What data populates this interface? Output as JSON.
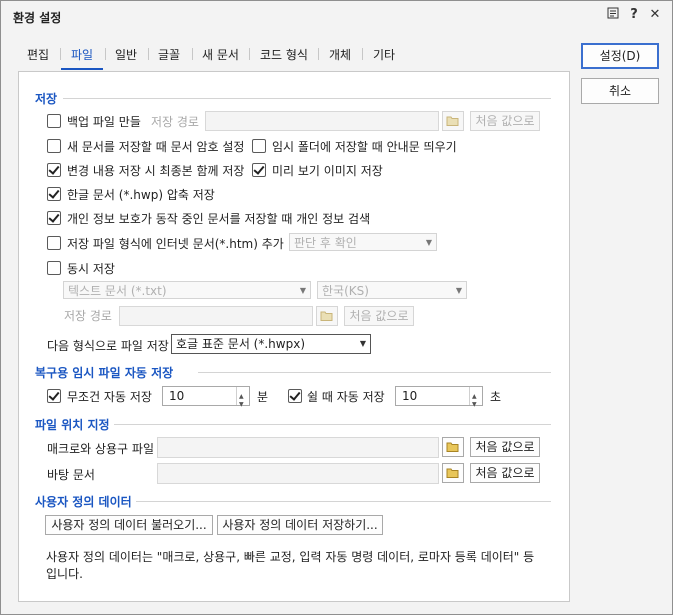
{
  "window": {
    "title": "환경 설정",
    "icons": [
      "layout-icon",
      "help-icon",
      "close-icon"
    ],
    "help_label": "?",
    "close_label": "✕"
  },
  "tabs": [
    "편집",
    "파일",
    "일반",
    "글꼴",
    "새 문서",
    "코드 형식",
    "개체",
    "기타"
  ],
  "active_tab": "파일",
  "buttons": {
    "ok": "설정(D)",
    "cancel": "취소"
  },
  "storage": {
    "title": "저장",
    "backup_label": "백업 파일 만들",
    "backup_checked": false,
    "save_path_label": "저장 경로",
    "default_btn": "처음 값으로",
    "encrypt_label": "새 문서를 저장할 때 문서 암호 설정",
    "encrypt_checked": false,
    "temp_notice_label": "임시 폴더에 저장할 때 안내문 띄우기",
    "temp_notice_checked": false,
    "history_label": "변경 내용 저장 시 최종본 함께 저장",
    "history_checked": true,
    "preview_label": "미리 보기 이미지 저장",
    "preview_checked": true,
    "compress_label": "한글 문서 (*.hwp) 압축 저장",
    "compress_checked": true,
    "privacy_label": "개인 정보 보호가 동작 중인 문서를 저장할 때 개인 정보 검색",
    "privacy_checked": true,
    "htm_label": "저장 파일 형식에 인터넷 문서(*.htm) 추가",
    "htm_checked": false,
    "htm_select": "판단 후 확인",
    "simul_label": "동시 저장",
    "simul_checked": false,
    "simul_format": "텍스트 문서 (*.txt)",
    "simul_encoding": "한국(KS)",
    "simul_path_label": "저장 경로",
    "simul_default_btn": "처음 값으로",
    "saveas_label": "다음 형식으로 파일 저장",
    "saveas_value": "호글 표준 문서 (*.hwpx)"
  },
  "autosave": {
    "title": "복구용 임시 파일 자동 저장",
    "always_label": "무조건 자동 저장",
    "always_checked": true,
    "always_value": "10",
    "always_unit": "분",
    "idle_label": "쉴 때 자동 저장",
    "idle_checked": true,
    "idle_value": "10",
    "idle_unit": "초"
  },
  "location": {
    "title": "파일 위치 지정",
    "macro_label": "매크로와 상용구 파일",
    "bg_label": "바탕 문서",
    "default_btn": "처음 값으로"
  },
  "userdata": {
    "title": "사용자 정의 데이터",
    "load_btn": "사용자 정의 데이터 불러오기...",
    "save_btn": "사용자 정의 데이터 저장하기...",
    "note": "사용자 정의 데이터는 \"매크로, 상용구, 빠른 교정, 입력 자동 명령 데이터, 로마자 등록 데이터\" 등입니다."
  }
}
